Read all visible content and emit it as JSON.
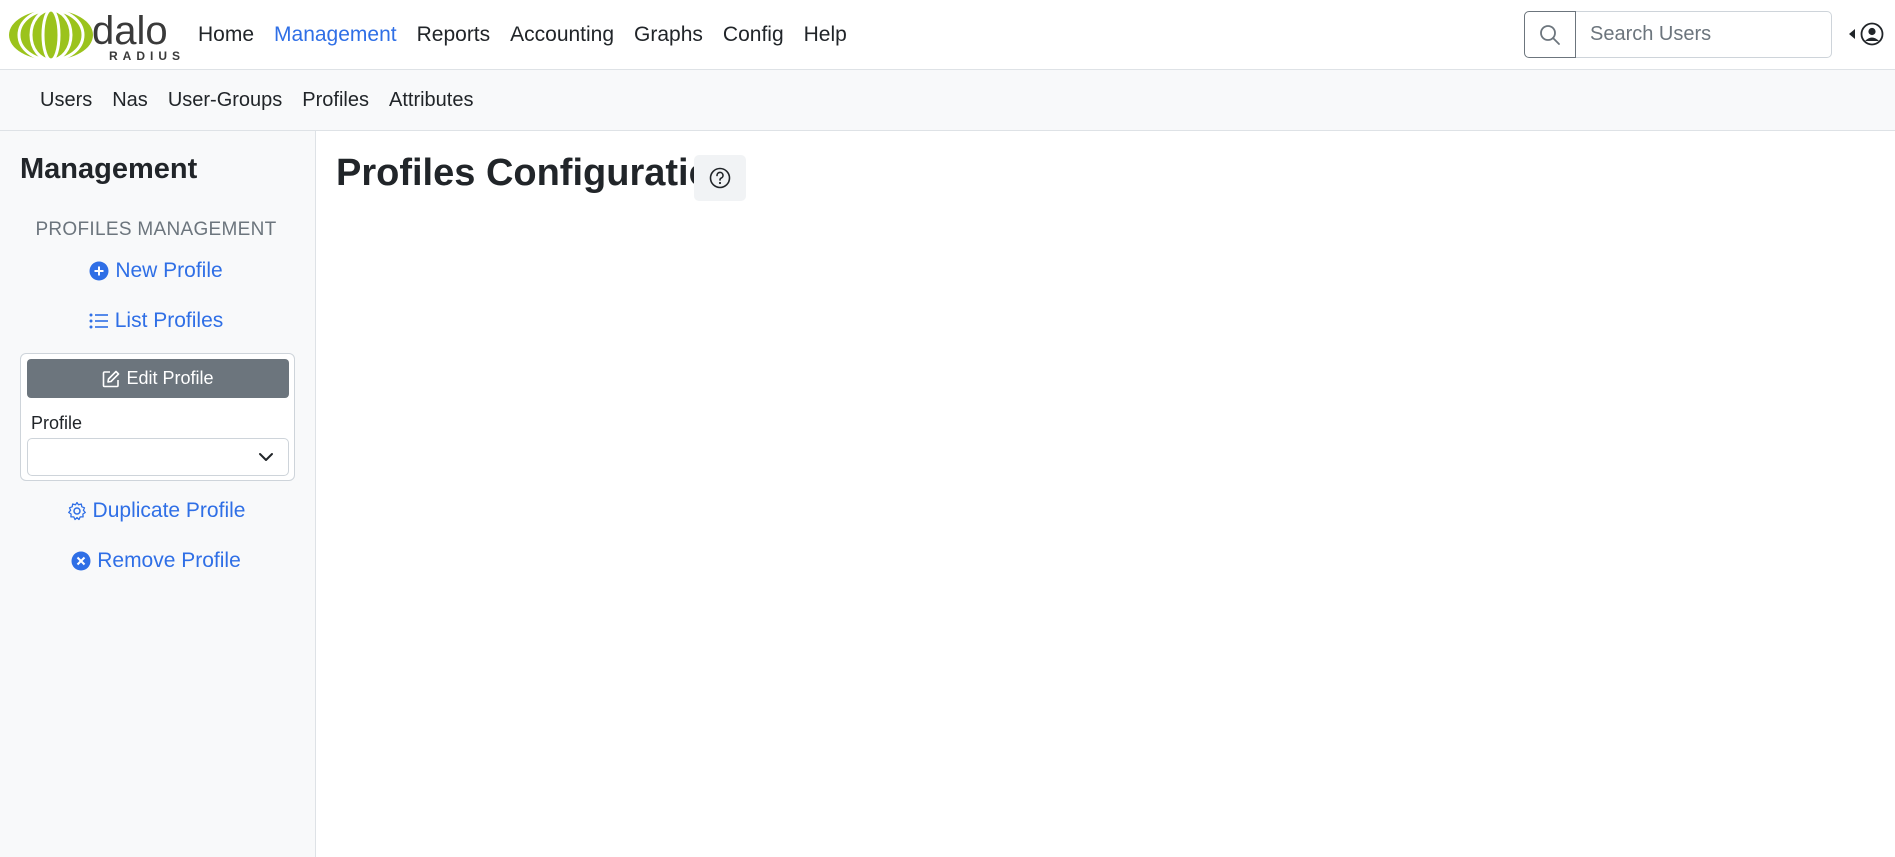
{
  "brand": {
    "name": "dalo",
    "sub": "RADIUS",
    "logo_color": "#9bc31c"
  },
  "main_nav": [
    {
      "label": "Home",
      "active": false
    },
    {
      "label": "Management",
      "active": true
    },
    {
      "label": "Reports",
      "active": false
    },
    {
      "label": "Accounting",
      "active": false
    },
    {
      "label": "Graphs",
      "active": false
    },
    {
      "label": "Config",
      "active": false
    },
    {
      "label": "Help",
      "active": false
    }
  ],
  "search": {
    "placeholder": "Search Users",
    "value": ""
  },
  "sub_nav": [
    "Users",
    "Nas",
    "User-Groups",
    "Profiles",
    "Attributes"
  ],
  "sidebar": {
    "title": "Management",
    "section": "PROFILES MANAGEMENT",
    "new_profile": "New Profile",
    "list_profiles": "List Profiles",
    "edit_profile": "Edit Profile",
    "profile_label": "Profile",
    "profile_selected": "",
    "duplicate_profile": "Duplicate Profile",
    "remove_profile": "Remove Profile"
  },
  "main": {
    "title": "Profiles Configuration"
  },
  "icons": {
    "search": "search-icon",
    "user_menu": "user-circle-icon",
    "new": "plus-circle-icon",
    "list": "list-icon",
    "edit": "edit-icon",
    "dropdown": "chevron-down-icon",
    "duplicate": "gear-icon",
    "remove": "x-circle-icon",
    "help": "question-circle-icon"
  },
  "colors": {
    "accent": "#2f6fe6",
    "edit_button": "#6c757d"
  }
}
